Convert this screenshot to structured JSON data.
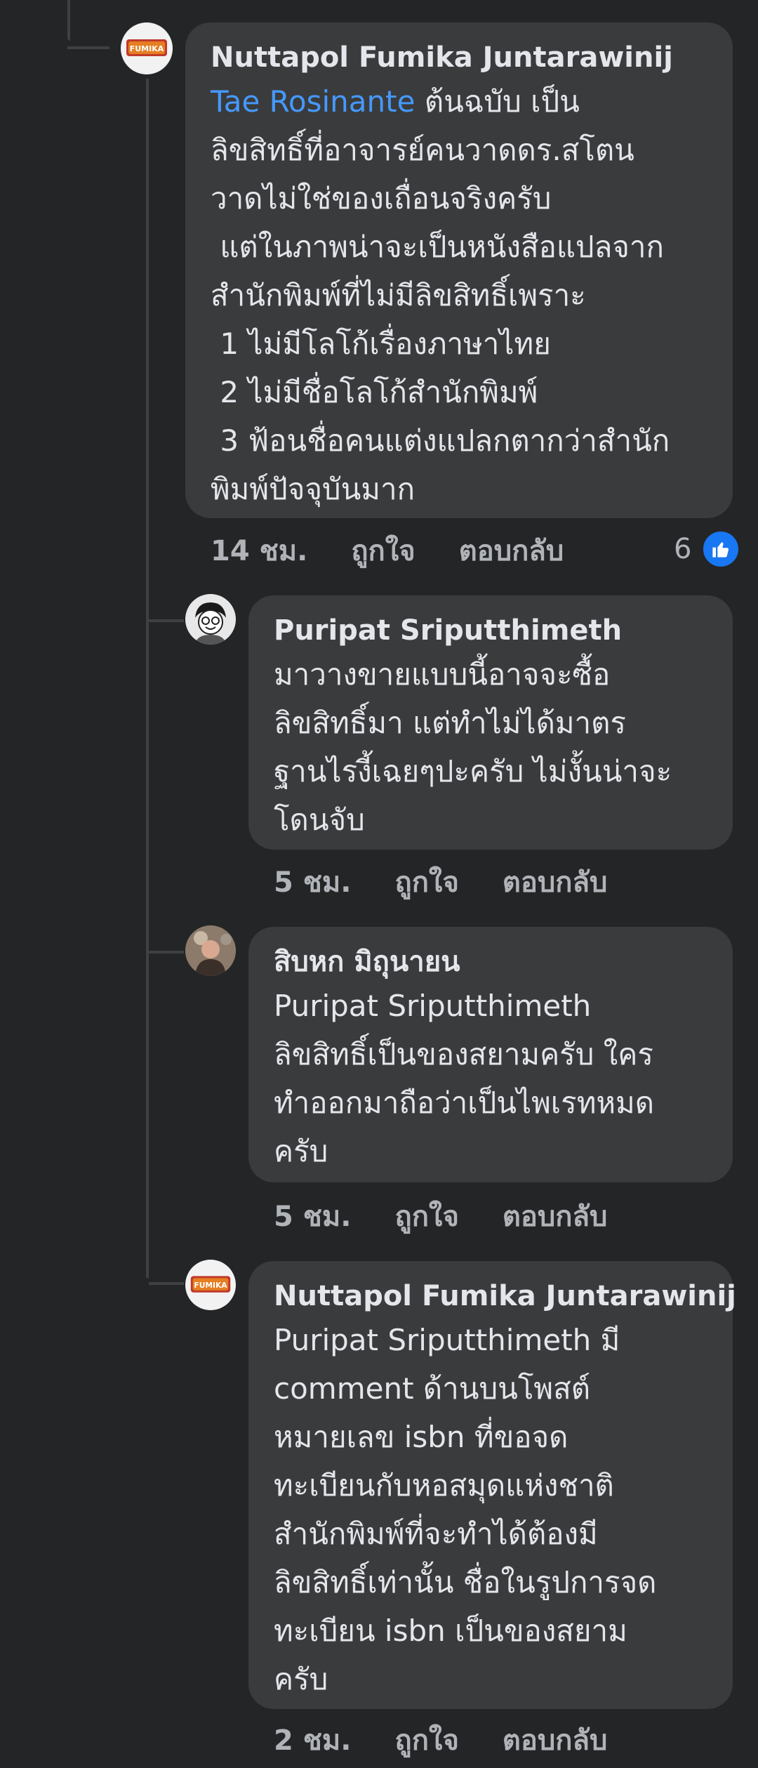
{
  "comments": [
    {
      "author": "Nuttapol Fumika Juntarawinij",
      "mention": "Tae Rosinante",
      "text": " ต้นฉบับ เป็น\nลิขสิทธิ์ที่อาจารย์คนวาดดร.สโตน\nวาดไม่ใช่ของเถื่อนจริงครับ\n แต่ในภาพน่าจะเป็นหนังสือแปลจาก\nสำนักพิมพ์ที่ไม่มีลิขสิทธิ์เพราะ\n 1 ไม่มีโลโก้เรื่องภาษาไทย\n 2 ไม่มีชื่อโลโก้สำนักพิมพ์\n 3 ฟ้อนชื่อคนแต่งแปลกตากว่าสำนัก\nพิมพ์ปัจจุบันมาก",
      "time": "14 ชม.",
      "like_label": "ถูกใจ",
      "reply_label": "ตอบกลับ",
      "reaction_count": "6",
      "avatar_text": "FUMIKA"
    },
    {
      "author": "Puripat Sriputthimeth",
      "text": "มาวางขายแบบนี้อาจจะซื้อ\nลิขสิทธิ์มา แต่ทำไม่ได้มาตร\nฐานไรงี้เฉยๆปะครับ ไม่งั้นน่าจะ\nโดนจับ",
      "time": "5 ชม.",
      "like_label": "ถูกใจ",
      "reply_label": "ตอบกลับ"
    },
    {
      "author": "สิบหก มิถุนายน",
      "text": "Puripat Sriputthimeth\nลิขสิทธิ์เป็นของสยามครับ ใคร\nทำออกมาถือว่าเป็นไพเรทหมด\nครับ",
      "time": "5 ชม.",
      "like_label": "ถูกใจ",
      "reply_label": "ตอบกลับ"
    },
    {
      "author": "Nuttapol Fumika Juntarawinij",
      "text": "Puripat Sriputthimeth มี\ncomment ด้านบนโพสต์\nหมายเลข isbn ที่ขอจด\nทะเบียนกับหอสมุดแห่งชาติ\nสำนักพิมพ์ที่จะทำได้ต้องมี\nลิขสิทธิ์เท่านั้น ชื่อในรูปการจด\nทะเบียน isbn เป็นของสยาม\nครับ",
      "time": "2 ชม.",
      "like_label": "ถูกใจ",
      "reply_label": "ตอบกลับ",
      "avatar_text": "FUMIKA"
    }
  ],
  "colors": {
    "background": "#242526",
    "bubble": "#3a3b3c",
    "mention": "#4599ff",
    "like": "#1877f2"
  }
}
